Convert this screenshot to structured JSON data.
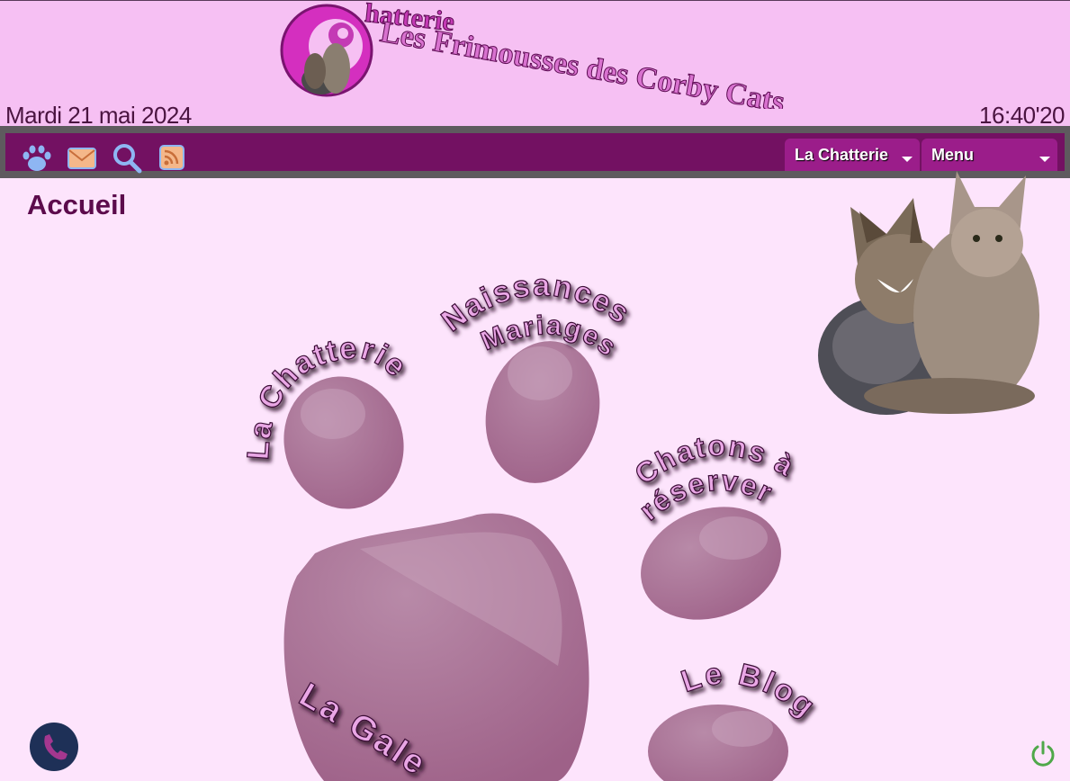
{
  "header": {
    "logo_alt": "Chatterie Les Frimousses des Corby Cats",
    "logo_line1": "hatterie",
    "logo_line2": "Les Frimousses des Corby Cats",
    "date": "Mardi 21 mai 2024",
    "time": "16:40'20"
  },
  "navbar": {
    "icons": [
      "paw-icon",
      "mail-icon",
      "search-icon",
      "rss-icon"
    ],
    "dropdowns": [
      {
        "label": "La Chatterie"
      },
      {
        "label": "Menu"
      }
    ]
  },
  "main": {
    "title": "Accueil",
    "paw_links": {
      "chatterie": "La Chatterie",
      "naissances": "Naissances",
      "mariages": "Mariages",
      "chatons": "Chatons à",
      "reserver": "réserver",
      "galerie": "La Galerie",
      "blog": "Le Blog"
    }
  },
  "colors": {
    "background": "#fde4fc",
    "header": "#f6c0f3",
    "navbar": "#731162",
    "paw": "#a3698f",
    "accent_text": "#e9a7e5"
  }
}
